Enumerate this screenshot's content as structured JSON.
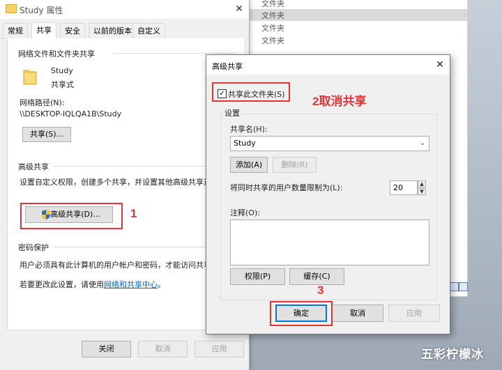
{
  "background": {
    "rows": [
      "文件夹",
      "文件夹",
      "文件夹",
      "文件夹"
    ]
  },
  "props": {
    "title": "Study 属性",
    "tabs": [
      "常规",
      "共享",
      "安全",
      "以前的版本",
      "自定义"
    ],
    "network_section_title": "网络文件和文件夹共享",
    "folder_name": "Study",
    "folder_status": "共享式",
    "network_path_label": "网络路径(N):",
    "network_path": "\\\\DESKTOP-IQLQA1B\\Study",
    "share_button": "共享(S)...",
    "advanced_section_title": "高级共享",
    "advanced_desc": "设置自定义权限，创建多个共享，并设置其他高级共享选项。",
    "advanced_button": "高级共享(D)...",
    "password_section_title": "密码保护",
    "password_desc": "用户必须具有此计算机的用户帐户和密码，才能访问共享文件",
    "change_settings_prefix": "若要更改此设置，请使用",
    "network_center_link": "网络和共享中心",
    "change_settings_suffix": "。",
    "close_button": "关闭",
    "cancel_button": "取消",
    "apply_button": "应用"
  },
  "dialog": {
    "title": "高级共享",
    "share_checkbox_label": "共享此文件夹(S)",
    "share_checked": true,
    "settings_label": "设置",
    "share_name_label": "共享名(H):",
    "share_name_value": "Study",
    "add_button": "添加(A)",
    "remove_button": "删除(R)",
    "limit_label": "将同时共享的用户数量限制为(L):",
    "limit_value": "20",
    "comments_label": "注释(O):",
    "permissions_button": "权限(P)",
    "caching_button": "缓存(C)",
    "ok_button": "确定",
    "cancel_button": "取消",
    "apply_button": "应用"
  },
  "annotations": {
    "step1": "1",
    "step2": "2取消共享",
    "step3": "3",
    "color": "#e53333"
  },
  "watermark": "五彩柠檬冰"
}
